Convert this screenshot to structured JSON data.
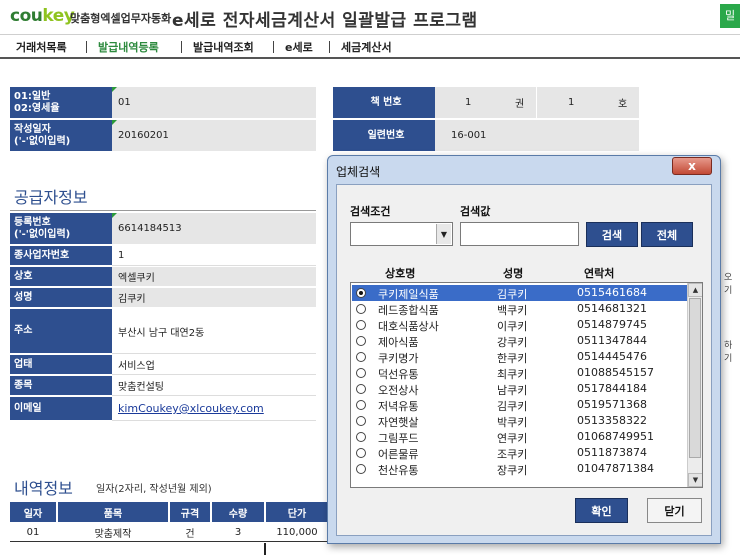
{
  "header": {
    "logo_co": "cou",
    "logo_key": "key",
    "logo_sub": "맞춤형엑셀업무자동화",
    "title": "e세로 전자세금계산서 일괄발급 프로그램",
    "right_tab": "밀"
  },
  "nav": [
    "거래처목록",
    "발급내역등록",
    "발급내역조회",
    "e세로",
    "세금계산서"
  ],
  "form": {
    "type_label": "01:일반\n02:영세율",
    "type_value": "01",
    "date_label": "작성일자\n('-'없이입력)",
    "date_value": "20160201",
    "book_label": "책 번호",
    "book_no": "1",
    "book_unit": "권",
    "book_no2": "1",
    "book_unit2": "호",
    "serial_label": "일련번호",
    "serial_value": "16-001"
  },
  "supplier": {
    "title": "공급자정보",
    "reg_label": "등록번호\n('-'없이입력)",
    "reg_value": "6614184513",
    "sub_label": "종사업자번호",
    "sub_value": "1",
    "name_label": "상호",
    "name_value": "엑셀쿠키",
    "ceo_label": "성명",
    "ceo_value": "김쿠키",
    "addr_label": "주소",
    "addr_value": "부산시 남구 대연2동",
    "biz_label": "업태",
    "biz_value": "서비스업",
    "item_label": "종목",
    "item_value": "맞춤컨설팅",
    "email_label": "이메일",
    "email_value": "kimCoukey@xlcoukey.com"
  },
  "details": {
    "title": "내역정보",
    "note": "일자(2자리, 작성년월 제외)",
    "headers": [
      "일자",
      "품목",
      "규격",
      "수량",
      "단가"
    ],
    "row": [
      "01",
      "맞춤제작",
      "건",
      "3",
      "110,000"
    ]
  },
  "dialog": {
    "title": "업체검색",
    "close": "x",
    "cond_label": "검색조건",
    "value_label": "검색값",
    "search_btn": "검색",
    "all_btn": "전체",
    "col_name": "상호명",
    "col_ceo": "성명",
    "col_phone": "연락처",
    "ok_btn": "확인",
    "close_btn": "닫기",
    "rows": [
      {
        "name": "쿠키제일식품",
        "ceo": "김쿠키",
        "phone": "0515461684"
      },
      {
        "name": "레드종합식품",
        "ceo": "백쿠키",
        "phone": "0514681321"
      },
      {
        "name": "대호식품상사",
        "ceo": "이쿠키",
        "phone": "0514879745"
      },
      {
        "name": "제아식품",
        "ceo": "강쿠키",
        "phone": "0511347844"
      },
      {
        "name": "쿠키명가",
        "ceo": "한쿠키",
        "phone": "0514445476"
      },
      {
        "name": "덕선유통",
        "ceo": "최쿠키",
        "phone": "01088545157"
      },
      {
        "name": "오전상사",
        "ceo": "남쿠키",
        "phone": "0517844184"
      },
      {
        "name": "저녁유통",
        "ceo": "김쿠키",
        "phone": "0519571368"
      },
      {
        "name": "자연햇살",
        "ceo": "박쿠키",
        "phone": "0513358322"
      },
      {
        "name": "그림푸드",
        "ceo": "연쿠키",
        "phone": "01068749951"
      },
      {
        "name": "어른물류",
        "ceo": "조쿠키",
        "phone": "0511873874"
      },
      {
        "name": "천산유통",
        "ceo": "장쿠키",
        "phone": "01047871384"
      }
    ],
    "selected_index": 0
  },
  "side": {
    "icon1_label": "오기",
    "icon2_label": "하기"
  },
  "colors": {
    "primary": "#2e4f8f",
    "accent_green": "#2d8a3e",
    "selection": "#3a6cc8"
  }
}
